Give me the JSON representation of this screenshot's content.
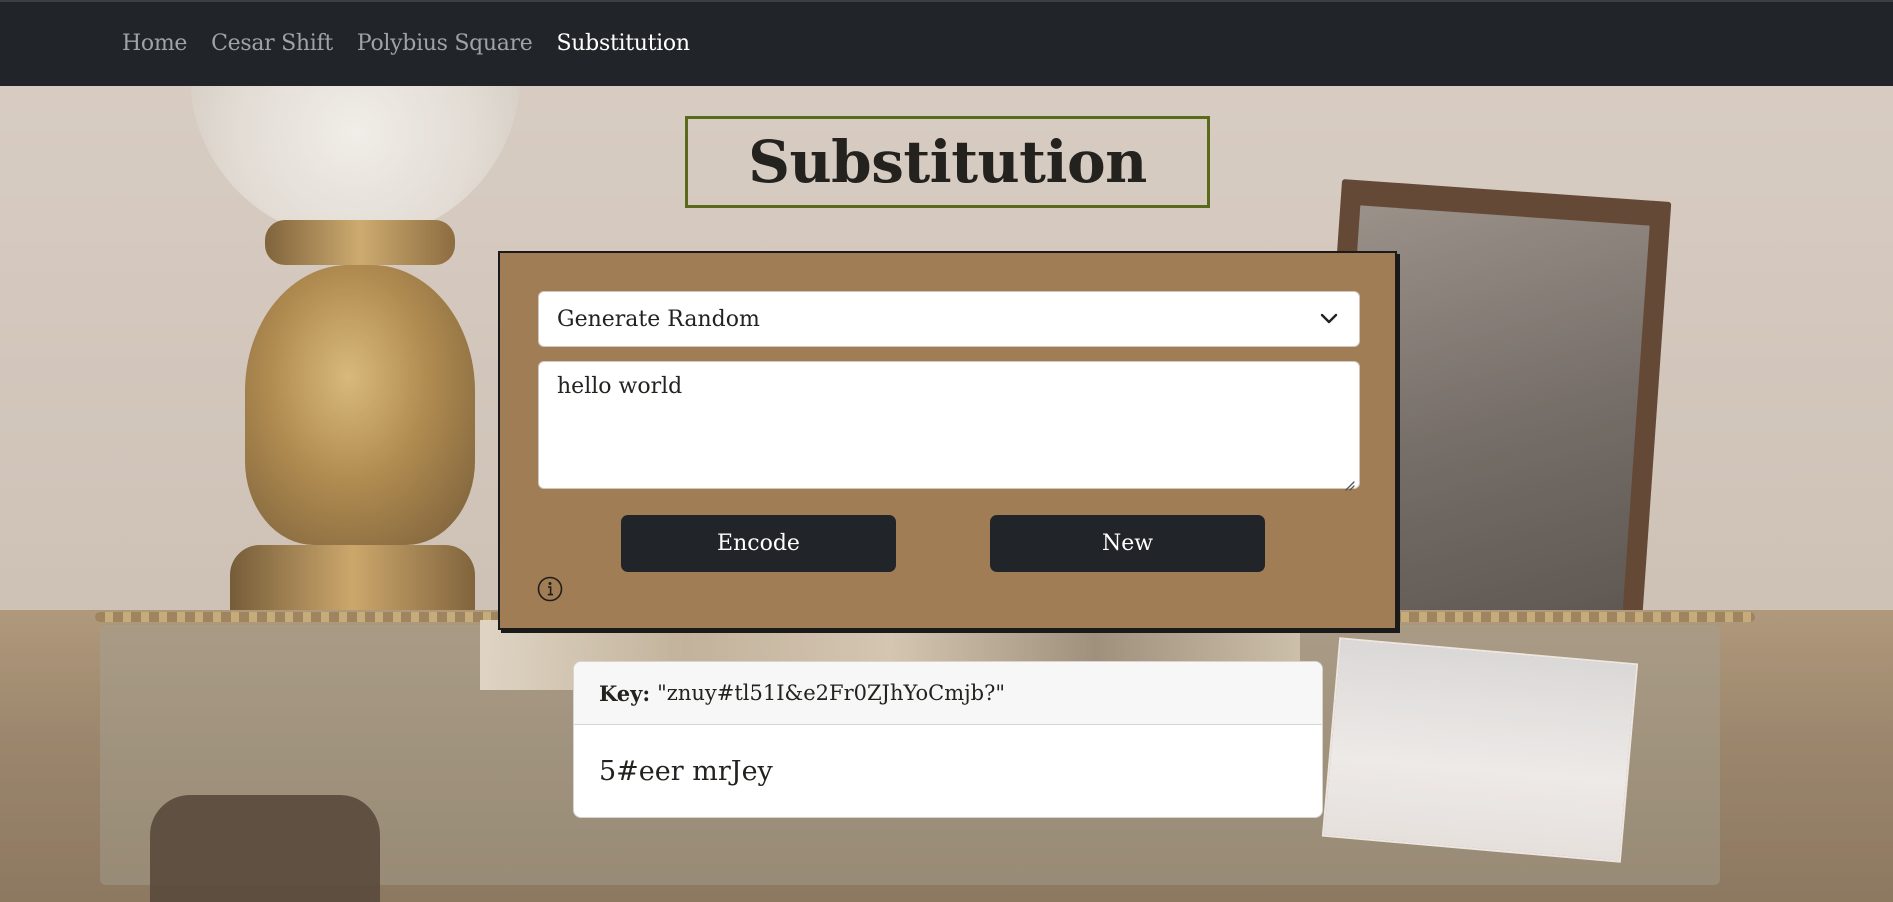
{
  "nav": {
    "items": [
      {
        "label": "Home",
        "active": false
      },
      {
        "label": "Cesar Shift",
        "active": false
      },
      {
        "label": "Polybius Square",
        "active": false
      },
      {
        "label": "Substitution",
        "active": true
      }
    ]
  },
  "page": {
    "title": "Substitution"
  },
  "form": {
    "key_mode_select": {
      "selected": "Generate Random",
      "icon": "chevron-down-icon"
    },
    "message_input": {
      "value": "hello world"
    },
    "encode_label": "Encode",
    "new_label": "New",
    "info_icon": "info-icon"
  },
  "result": {
    "key_label": "Key:",
    "key_value": "\"znuy#tl51I&e2Fr0ZJhYoCmjb?\"",
    "output": "5#eer mrJey"
  },
  "colors": {
    "navbar": "#212529",
    "panel": "#a07d55",
    "title_border": "#5b6a1a",
    "button": "#212529"
  }
}
